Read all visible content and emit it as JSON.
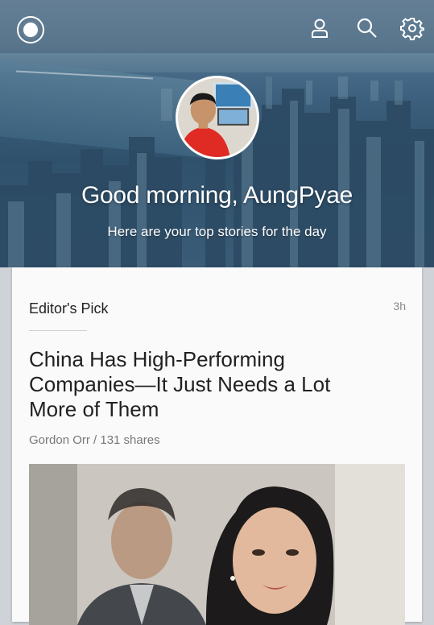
{
  "header": {
    "greeting": "Good morning, AungPyae",
    "subtitle": "Here are your top stories for the day",
    "icons": [
      "logo-icon",
      "profile-icon",
      "search-icon",
      "settings-icon"
    ]
  },
  "card": {
    "section_label": "Editor's Pick",
    "time": "3h",
    "headline": "China Has High-Performing Companies—It Just Needs a Lot More of Them",
    "byline": "Gordon Orr / 131 shares"
  },
  "colors": {
    "header_tint": "#3b5f7c",
    "card_bg": "#fafafa",
    "page_bg": "#cfd3d8"
  }
}
